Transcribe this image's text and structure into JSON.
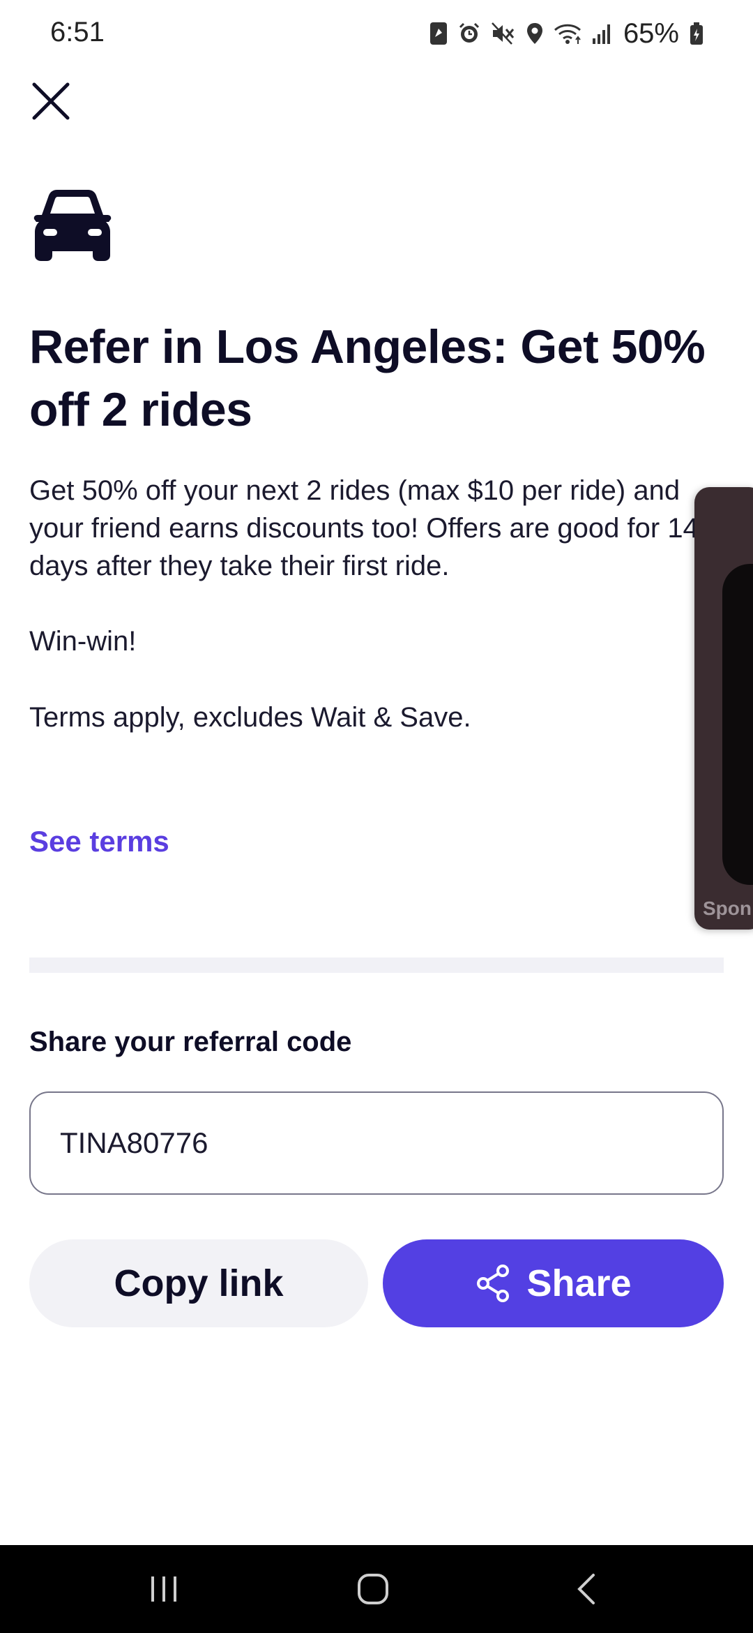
{
  "status_bar": {
    "time": "6:51",
    "battery": "65%",
    "icons": [
      "sim-icon",
      "alarm-icon",
      "mute-icon",
      "location-icon",
      "wifi-icon",
      "signal-icon",
      "battery-icon"
    ]
  },
  "header": {
    "close_icon": "close-icon",
    "car_icon": "car-icon"
  },
  "offer": {
    "title": "Refer in Los Angeles: Get 50% off 2 rides",
    "description": "Get 50% off your next 2 rides (max $10 per ride) and your friend earns discounts too! Offers are good for 14 days after they take their first ride.",
    "win": "Win-win!",
    "terms_note": "Terms apply, excludes Wait & Save.",
    "see_terms": "See terms"
  },
  "side_card": {
    "label": "Spon"
  },
  "referral": {
    "label": "Share your referral code",
    "code": "TINA80776"
  },
  "actions": {
    "copy_label": "Copy link",
    "share_label": "Share",
    "share_icon": "share-icon"
  },
  "colors": {
    "accent": "#5340e3",
    "link": "#5a3ee0",
    "text": "#0e0d26",
    "button_secondary": "#f2f2f6"
  },
  "nav": {
    "items": [
      "recent-apps-icon",
      "home-icon",
      "back-icon"
    ]
  }
}
